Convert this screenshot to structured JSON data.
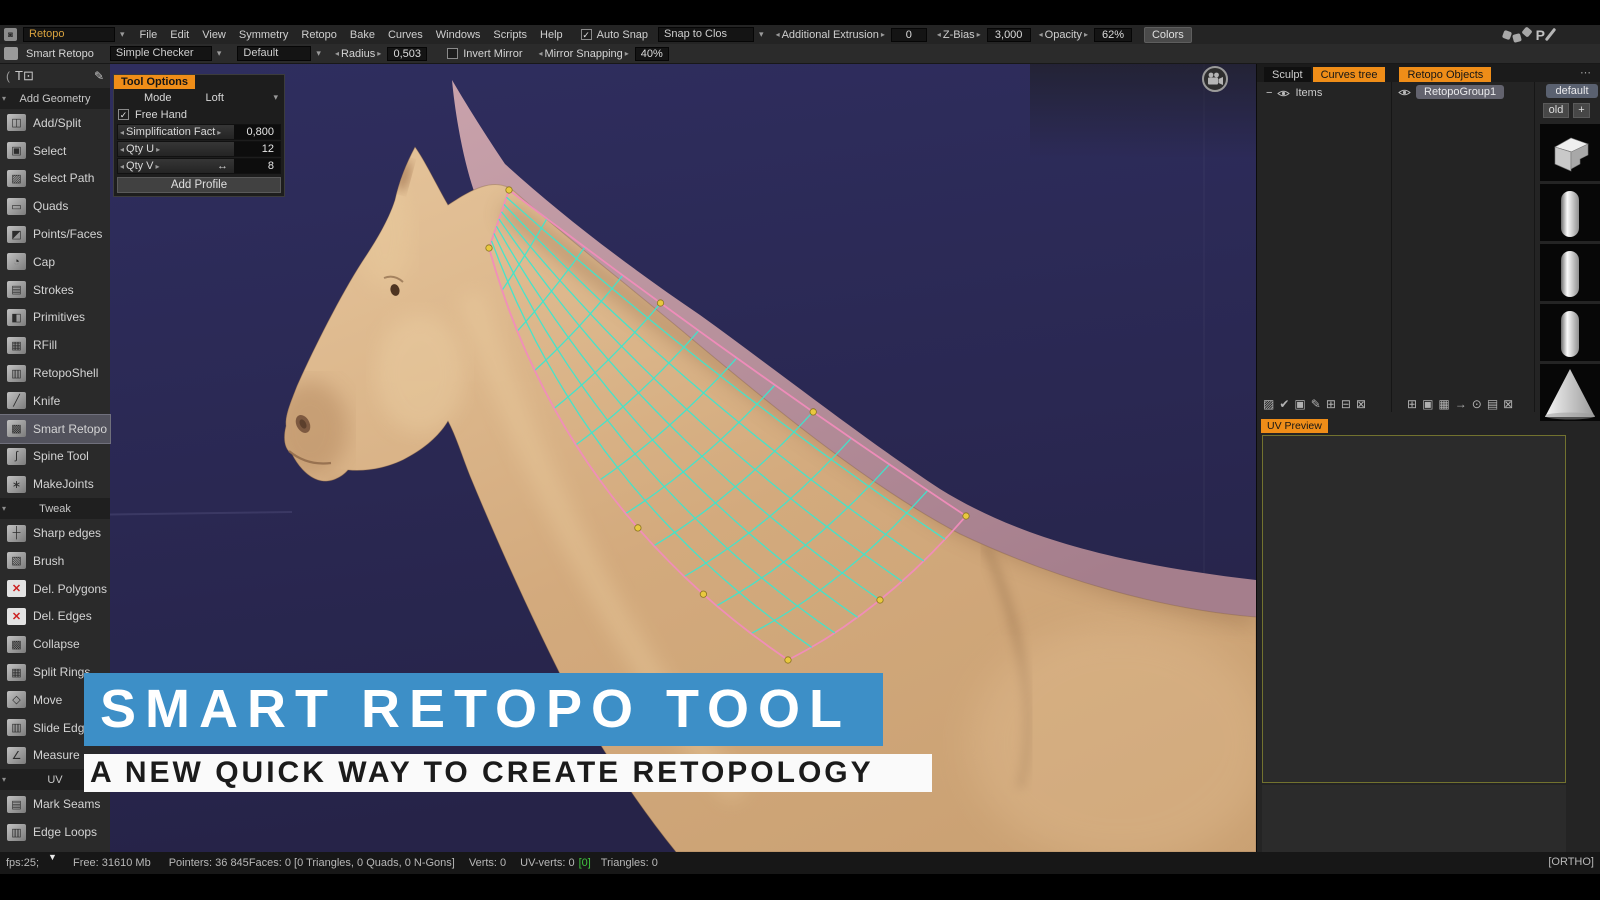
{
  "menu_bar": {
    "workspace": "Retopo",
    "menus": [
      "File",
      "Edit",
      "View",
      "Symmetry",
      "Retopo",
      "Bake",
      "Curves",
      "Windows",
      "Scripts",
      "Help"
    ],
    "auto_snap_label": "Auto Snap",
    "snap_mode_value": "Snap to Clos",
    "additional_extrusion_label": "Additional Extrusion",
    "additional_extrusion_value": "0",
    "z_bias_label": "Z-Bias",
    "z_bias_value": "3,000",
    "opacity_label": "Opacity",
    "opacity_value": "62%",
    "colors_button": "Colors"
  },
  "tool_bar": {
    "tool_name": "Smart Retopo",
    "checker_value": "Simple Checker",
    "preset_value": "Default",
    "radius_label": "Radius",
    "radius_value": "0,503",
    "invert_mirror_label": "Invert Mirror",
    "mirror_snapping_label": "Mirror Snapping",
    "mirror_snapping_value": "40%"
  },
  "sidebar": {
    "selected_tool": "Smart Retopo",
    "sections": [
      {
        "header": "Add Geometry",
        "items": [
          {
            "label": "Add/Split",
            "icon": "add-split-icon"
          },
          {
            "label": "Select",
            "icon": "select-icon"
          },
          {
            "label": "Select Path",
            "icon": "select-path-icon"
          },
          {
            "label": "Quads",
            "icon": "quads-icon"
          },
          {
            "label": "Points/Faces",
            "icon": "points-faces-icon"
          },
          {
            "label": "Cap",
            "icon": "cap-icon"
          },
          {
            "label": "Strokes",
            "icon": "strokes-icon"
          },
          {
            "label": "Primitives",
            "icon": "primitives-icon"
          },
          {
            "label": "RFill",
            "icon": "rfill-icon"
          },
          {
            "label": "RetopoShell",
            "icon": "retoposhell-icon"
          },
          {
            "label": "Knife",
            "icon": "knife-icon"
          },
          {
            "label": "Smart Retopo",
            "icon": "smart-retopo-icon"
          },
          {
            "label": "Spine Tool",
            "icon": "spine-tool-icon"
          },
          {
            "label": "MakeJoints",
            "icon": "makejoints-icon"
          }
        ]
      },
      {
        "header": "Tweak",
        "items": [
          {
            "label": "Sharp edges",
            "icon": "sharp-edges-icon"
          },
          {
            "label": "Brush",
            "icon": "brush-icon"
          },
          {
            "label": "Del. Polygons",
            "icon": "del-polygons-icon"
          },
          {
            "label": "Del. Edges",
            "icon": "del-edges-icon"
          },
          {
            "label": "Collapse",
            "icon": "collapse-icon"
          },
          {
            "label": "Split Rings",
            "icon": "split-rings-icon"
          },
          {
            "label": "Move",
            "icon": "move-icon"
          },
          {
            "label": "Slide Edges",
            "icon": "slide-edges-icon"
          },
          {
            "label": "Measure",
            "icon": "measure-icon"
          }
        ]
      },
      {
        "header": "UV",
        "items": [
          {
            "label": "Mark Seams",
            "icon": "mark-seams-icon"
          },
          {
            "label": "Edge Loops",
            "icon": "edge-loops-icon"
          }
        ]
      }
    ]
  },
  "tool_options": {
    "title": "Tool Options",
    "mode_label": "Mode",
    "mode_value": "Loft",
    "free_hand_label": "Free Hand",
    "free_hand_checked": true,
    "sliders": [
      {
        "label": "Simplification Fact",
        "value": "0,800",
        "resize_arrow": false
      },
      {
        "label": "Qty U",
        "value": "12",
        "resize_arrow": false
      },
      {
        "label": "Qty V",
        "value": "8",
        "resize_arrow": true
      }
    ],
    "add_profile_button": "Add Profile"
  },
  "right_panel": {
    "tabs": [
      {
        "label": "Sculpt",
        "active": false
      },
      {
        "label": "Curves tree",
        "active": true
      },
      {
        "label": "Retopo Objects",
        "active": true
      }
    ],
    "curves_tree": {
      "item_label": "Items"
    },
    "retopo_objects": {
      "group_name": "RetopoGroup1"
    },
    "presets": {
      "default_label": "default",
      "old_label": "old",
      "add_label": "+",
      "thumbnails": [
        "angle-shape",
        "capsule",
        "capsule",
        "capsule",
        "cone"
      ]
    },
    "uv_preview_tab": "UV Preview"
  },
  "banner": {
    "title": "SMART RETOPO TOOL",
    "subtitle": "A NEW QUICK WAY TO CREATE RETOPOLOGY"
  },
  "status_bar": {
    "fps": "fps:25;",
    "free": "Free: 31610 Mb",
    "pointers": "Pointers: 36 845",
    "faces": "Faces: 0 [0 Triangles, 0 Quads, 0 N-Gons]",
    "verts": "Verts: 0",
    "uv_verts": "UV-verts: 0",
    "uv_selected": "[0]",
    "triangles": "Triangles: 0",
    "projection": "[ORTHO]"
  },
  "colors": {
    "accent_orange": "#ef8d18",
    "banner_blue": "#3d8fc7",
    "viewport_navy": "#2b2a55",
    "mesh_cyan": "#3fe5cc",
    "mesh_pink": "#f18cbc",
    "vertex_yellow": "#e9c83e"
  }
}
